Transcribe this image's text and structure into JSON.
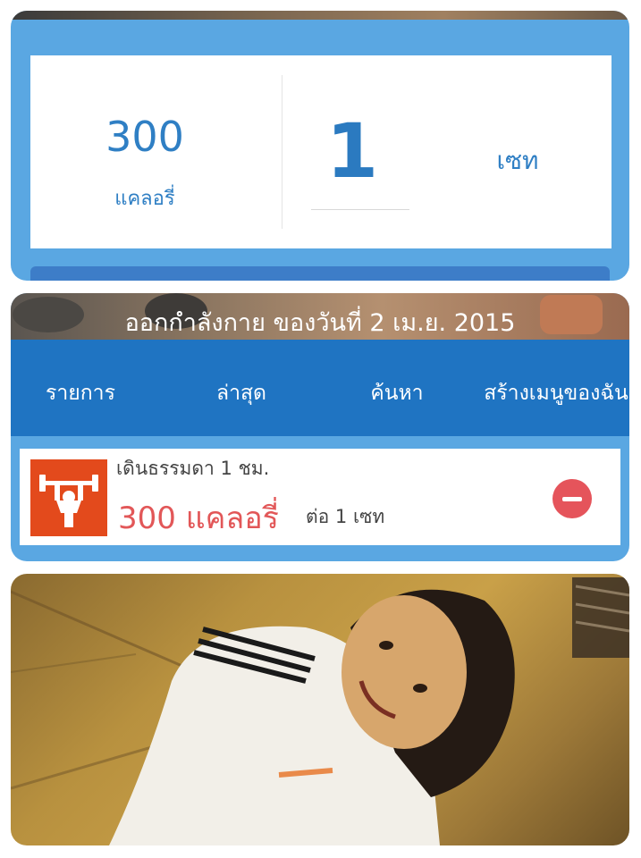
{
  "summary": {
    "calories_value": "300",
    "calories_unit": "แคลอรี่",
    "sets_value": "1",
    "sets_unit": "เซท"
  },
  "exercise_header": {
    "title": "ออกกำลังกาย ของวันที่ 2 เม.ย. 2015"
  },
  "tabs": [
    {
      "label": "รายการ",
      "active": true
    },
    {
      "label": "ล่าสุด",
      "active": false
    },
    {
      "label": "ค้นหา",
      "active": false
    },
    {
      "label": "สร้างเมนูของฉัน",
      "active": false
    }
  ],
  "exercise_item": {
    "name": "เดินธรรมดา 1 ชม.",
    "calories": "300 แคลอรี่",
    "per_set": "ต่อ 1 เซท",
    "icon": "weightlifting-icon"
  },
  "colors": {
    "accent_blue": "#1f74c2",
    "panel_blue": "#5aa7e2",
    "number_blue": "#2f7fc4",
    "calorie_red": "#e25758",
    "icon_orange": "#e34a1c",
    "remove_red": "#e5545b"
  }
}
